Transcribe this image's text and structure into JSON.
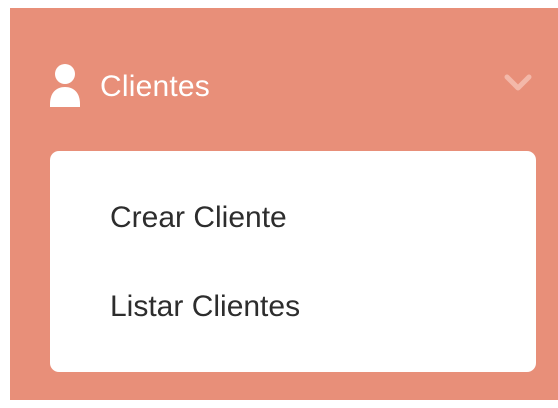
{
  "menu": {
    "section": {
      "label": "Clientes",
      "icon": "user-icon",
      "expand_icon": "chevron-down-icon",
      "expanded": true
    },
    "items": [
      {
        "label": "Crear Cliente"
      },
      {
        "label": "Listar Clientes"
      }
    ]
  },
  "colors": {
    "panel_background": "#e88f79",
    "submenu_background": "#ffffff",
    "header_text": "#ffffff",
    "chevron": "#f3b8a9",
    "item_text": "#2d2d2d"
  }
}
